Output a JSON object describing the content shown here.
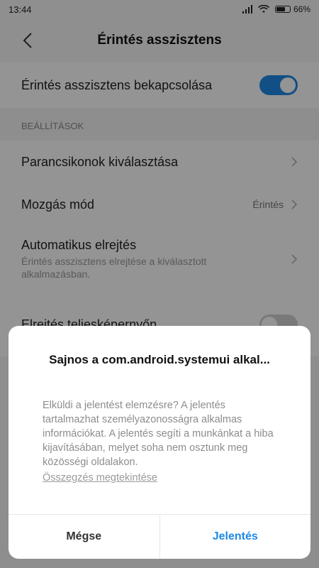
{
  "status_bar": {
    "time": "13:44",
    "battery": "66%"
  },
  "header": {
    "title": "Érintés asszisztens"
  },
  "main_toggle": {
    "label": "Érintés asszisztens bekapcsolása",
    "state": "on"
  },
  "section": {
    "label": "BEÁLLÍTÁSOK"
  },
  "settings": {
    "shortcuts": {
      "label": "Parancsikonok kiválasztása"
    },
    "movement": {
      "label": "Mozgás mód",
      "value": "Érintés"
    },
    "autohide": {
      "label": "Automatikus elrejtés",
      "subtitle": "Érintés asszisztens elrejtése a kiválasztott alkalmazásban."
    },
    "fullscreen_hide": {
      "label": "Elrejtés teljesképernyőn",
      "state": "off"
    }
  },
  "dialog": {
    "title": "Sajnos a com.android.systemui alkal...",
    "message": "Elküldi a jelentést elemzésre? A jelentés tartalmazhat személyazonosságra alkalmas információkat. A jelentés segíti a munkánkat a hiba kijavításában, melyet soha nem osztunk meg közösségi oldalakon.",
    "link": "Összegzés megtekintése",
    "cancel": "Mégse",
    "report": "Jelentés"
  },
  "colors": {
    "accent": "#1e88e5"
  }
}
